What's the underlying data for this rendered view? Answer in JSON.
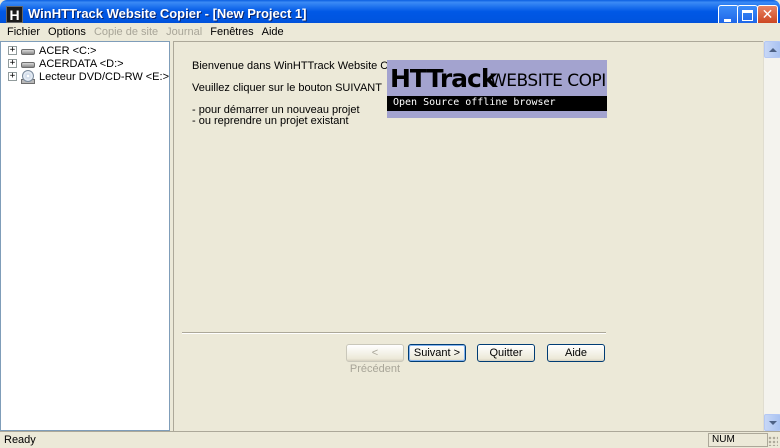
{
  "window": {
    "title": "WinHTTrack Website Copier - [New Project 1]",
    "app_icon_letter": "H",
    "controls": {
      "minimize": "minimize-icon",
      "maximize": "maximize-icon",
      "close": "✕"
    }
  },
  "menu": {
    "items": [
      {
        "label": "Fichier",
        "enabled": true
      },
      {
        "label": "Options",
        "enabled": true
      },
      {
        "label": "Copie de site",
        "enabled": false
      },
      {
        "label": "Journal",
        "enabled": false
      },
      {
        "label": "Fenêtres",
        "enabled": true
      },
      {
        "label": "Aide",
        "enabled": true
      }
    ]
  },
  "tree": {
    "items": [
      {
        "label": "ACER <C:>",
        "expander": "+",
        "icon": "hard-drive-icon"
      },
      {
        "label": "ACERDATA <D:>",
        "expander": "+",
        "icon": "hard-drive-icon"
      },
      {
        "label": "Lecteur DVD/CD-RW <E:>",
        "expander": "+",
        "icon": "cd-drive-icon"
      }
    ]
  },
  "main": {
    "welcome": "Bienvenue dans WinHTTrack Website Copier!",
    "instruction": "Veuillez cliquer sur le bouton SUIVANT",
    "options": [
      "- pour démarrer un nouveau projet",
      "- ou reprendre un projet existant"
    ],
    "banner": {
      "logo_main": "HTTrack",
      "logo_small": "WEBSITE COPIER",
      "tagline": "Open Source offline browser"
    }
  },
  "buttons": {
    "previous": "< Précédent",
    "next": "Suivant >",
    "quit": "Quitter",
    "help": "Aide"
  },
  "status": {
    "text": "Ready",
    "indicator": "NUM"
  }
}
